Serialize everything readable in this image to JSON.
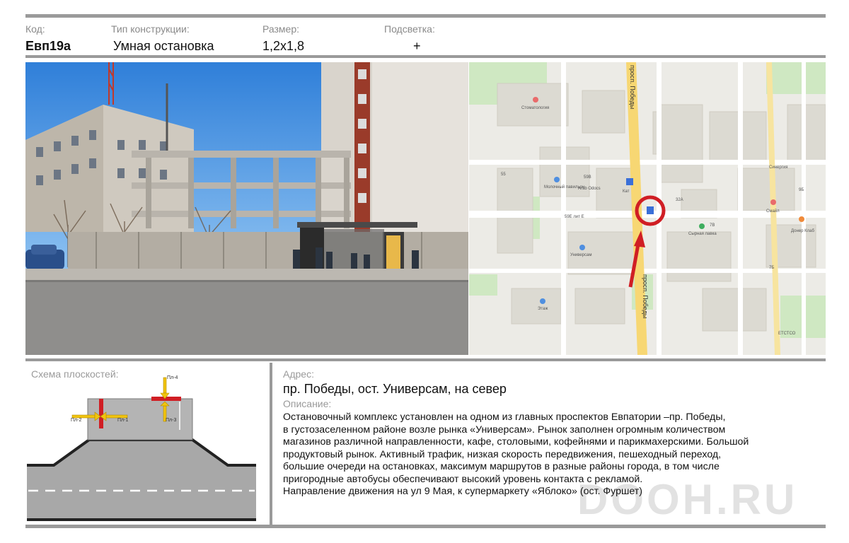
{
  "header": {
    "code_label": "Код:",
    "code_value": "Евп19а",
    "type_label": "Тип конструкции:",
    "type_value": "Умная остановка",
    "size_label": "Размер:",
    "size_value": "1,2x1,8",
    "light_label": "Подсветка:",
    "light_value": "+"
  },
  "map": {
    "labels": {
      "street_top": "просп. Победы",
      "street_bottom": "просп. Победы",
      "dentistry": "Стоматология",
      "molochny": "Молочный павильон",
      "arab": "Arab Odocs",
      "kat": "Кат",
      "universam": "Универсам",
      "etazh": "Этаж",
      "sinergiya": "Синергия",
      "smile": "Смайл",
      "syrnaya": "Сырная лавка",
      "doner": "Донер Клаб",
      "etstso": "ЕТСТСО",
      "n55": "55",
      "n59v": "59В",
      "n59e": "59Е лит Е",
      "n32a": "32А",
      "n9b": "9В",
      "n7b": "7В",
      "n7b2": "7Б",
      "n9b2": "9Б"
    }
  },
  "schema": {
    "title": "Схема плоскостей:",
    "pl1": "Пл-1",
    "pl2": "Пл-2",
    "pl3": "Пл-3",
    "pl4": "Пл-4"
  },
  "address": {
    "label": "Адрес:",
    "value": "пр. Победы, ост. Универсам, на север"
  },
  "description": {
    "label": "Описание:",
    "lines": [
      "Остановочный комплекс установлен на одном из главных проспектов Евпатории –пр. Победы,",
      "в густозаселенном районе возле рынка «Универсам». Рынок заполнен огромным количеством",
      "магазинов различной направленности, кафе, столовыми, кофейнями и парикмахерскими. Большой",
      "продуктовый рынок. Активный трафик, низкая скорость передвижения, пешеходный переход,",
      "большие очереди на остановках, максимум маршрутов в разные районы города, в том числе",
      "пригородные автобусы обеспечивают высокий уровень контакта с рекламой.",
      "Направление движения на ул 9 Мая, к супермаркету «Яблоко» (ост. Фуршет)"
    ]
  },
  "watermark": "DOOH.RU",
  "colors": {
    "accent_red": "#d01e24",
    "arrow_yellow": "#f1c40f",
    "rule_gray": "#9a9a9a",
    "road_gray": "#a8a8a8"
  }
}
